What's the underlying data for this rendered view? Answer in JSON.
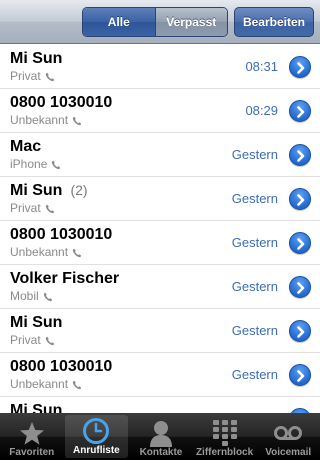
{
  "navbar": {
    "segments": [
      {
        "label": "Alle",
        "active": true
      },
      {
        "label": "Verpasst",
        "active": false
      }
    ],
    "edit_label": "Bearbeiten"
  },
  "calls": [
    {
      "name": "Mi Sun",
      "count": "",
      "type": "Privat",
      "time": "08:31"
    },
    {
      "name": "0800 1030010",
      "count": "",
      "type": "Unbekannt",
      "time": "08:29"
    },
    {
      "name": "Mac",
      "count": "",
      "type": "iPhone",
      "time": "Gestern"
    },
    {
      "name": "Mi Sun",
      "count": "(2)",
      "type": "Privat",
      "time": "Gestern"
    },
    {
      "name": "0800 1030010",
      "count": "",
      "type": "Unbekannt",
      "time": "Gestern"
    },
    {
      "name": "Volker Fischer",
      "count": "",
      "type": "Mobil",
      "time": "Gestern"
    },
    {
      "name": "Mi Sun",
      "count": "",
      "type": "Privat",
      "time": "Gestern"
    },
    {
      "name": "0800 1030010",
      "count": "",
      "type": "Unbekannt",
      "time": "Gestern"
    },
    {
      "name": "Mi Sun",
      "count": "",
      "type": "",
      "time": ""
    }
  ],
  "tabs": [
    {
      "label": "Favoriten",
      "icon": "star-icon",
      "active": false
    },
    {
      "label": "Anrufliste",
      "icon": "clock-icon",
      "active": true
    },
    {
      "label": "Kontakte",
      "icon": "person-icon",
      "active": false
    },
    {
      "label": "Ziffernblock",
      "icon": "keypad-icon",
      "active": false
    },
    {
      "label": "Voicemail",
      "icon": "voicemail-icon",
      "active": false
    }
  ],
  "colors": {
    "accent": "#3d6eb4",
    "disclosure": "#2d74d8",
    "active_tab_icon": "#4aa3ea"
  }
}
